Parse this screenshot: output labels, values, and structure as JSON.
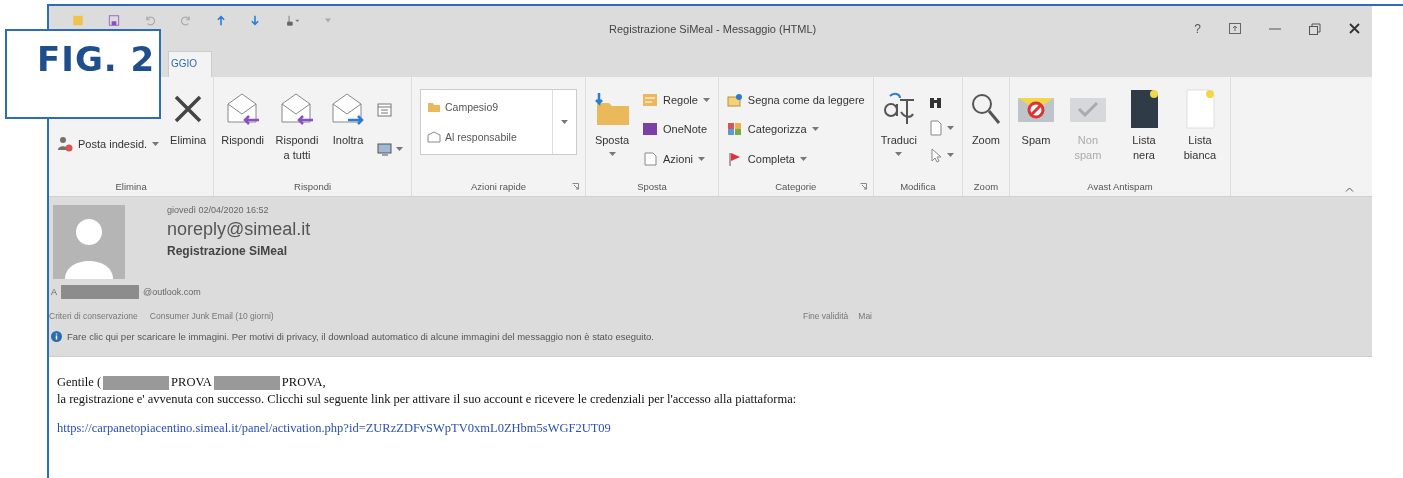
{
  "figure_label": "FIG. 2",
  "window": {
    "title": "Registrazione SiMeal - Messaggio (HTML)",
    "help": "?"
  },
  "tabs": [
    {
      "label": "GGIO",
      "selected": true
    }
  ],
  "ribbon": {
    "groups": [
      {
        "name": "Elimina",
        "items": [
          {
            "kind": "small",
            "label": "Posta indesid.",
            "dropdown": true,
            "disabled": false
          },
          {
            "kind": "large",
            "label": "Elimina",
            "disabled": false
          }
        ]
      },
      {
        "name": "Rispondi",
        "items": [
          {
            "kind": "large",
            "label": "Rispondi",
            "disabled": false
          },
          {
            "kind": "large",
            "label": "Rispondi a tutti",
            "disabled": false
          },
          {
            "kind": "large",
            "label": "Inoltra",
            "disabled": false
          },
          {
            "kind": "icons"
          }
        ]
      },
      {
        "name": "Azioni rapide",
        "launcher": true,
        "items": [
          {
            "kind": "gallery",
            "entries": [
              "Campesio9",
              "Al responsabile"
            ]
          }
        ]
      },
      {
        "name": "Sposta",
        "items": [
          {
            "kind": "large",
            "label": "Sposta",
            "dropdown": true,
            "disabled": false
          },
          {
            "kind": "column",
            "entries": [
              {
                "label": "Regole",
                "dropdown": true
              },
              {
                "label": "OneNote"
              },
              {
                "label": "Azioni",
                "dropdown": true
              }
            ]
          }
        ]
      },
      {
        "name": "Categorie",
        "launcher": true,
        "items": [
          {
            "kind": "column",
            "entries": [
              {
                "label": "Segna come da leggere"
              },
              {
                "label": "Categorizza",
                "dropdown": true
              },
              {
                "label": "Completa",
                "dropdown": true
              }
            ]
          }
        ]
      },
      {
        "name": "Modifica",
        "items": [
          {
            "kind": "large",
            "label": "Traduci",
            "dropdown": true,
            "disabled": false
          },
          {
            "kind": "icons"
          }
        ]
      },
      {
        "name": "Zoom",
        "items": [
          {
            "kind": "large",
            "label": "Zoom",
            "disabled": false
          }
        ]
      },
      {
        "name": "Avast Antispam",
        "items": [
          {
            "kind": "large",
            "label": "Spam",
            "disabled": false
          },
          {
            "kind": "large",
            "label": "Non spam",
            "disabled": true
          },
          {
            "kind": "large",
            "label": "Lista nera",
            "disabled": false
          },
          {
            "kind": "large",
            "label": "Lista bianca",
            "disabled": false
          }
        ]
      }
    ]
  },
  "header": {
    "date": "giovedì 02/04/2020 16:52",
    "sender": "noreply@simeal.it",
    "subject": "Registrazione SiMeal",
    "to_label": "A",
    "to_domain": "@outlook.com",
    "retention_label": "Criteri di conservazione",
    "retention_value": "Consumer Junk Email (10 giorni)",
    "expiry_label": "Fine validità",
    "expiry_value": "Mai"
  },
  "info_bar": "Fare clic qui per scaricare le immagini. Per motivi di privacy, il download automatico di alcune immagini del messaggio non è stato eseguito.",
  "body": {
    "greeting": [
      {
        "kind": "text",
        "text": "Gentile ("
      },
      {
        "kind": "redacted"
      },
      {
        "kind": "text",
        "text": "PROVA"
      },
      {
        "kind": "redacted"
      },
      {
        "kind": "text",
        "text": "PROVA,"
      }
    ],
    "paragraph": "la registrazione e' avvenuta con successo. Clicchi sul seguente link per attivare il suo account e ricevere le credenziali per l'accesso alla piattaforma:",
    "link": "https://carpanetopiacentino.simeal.it/panel/activation.php?id=ZURzZDFvSWpTV0xmL0ZHbm5sWGF2UT09"
  }
}
